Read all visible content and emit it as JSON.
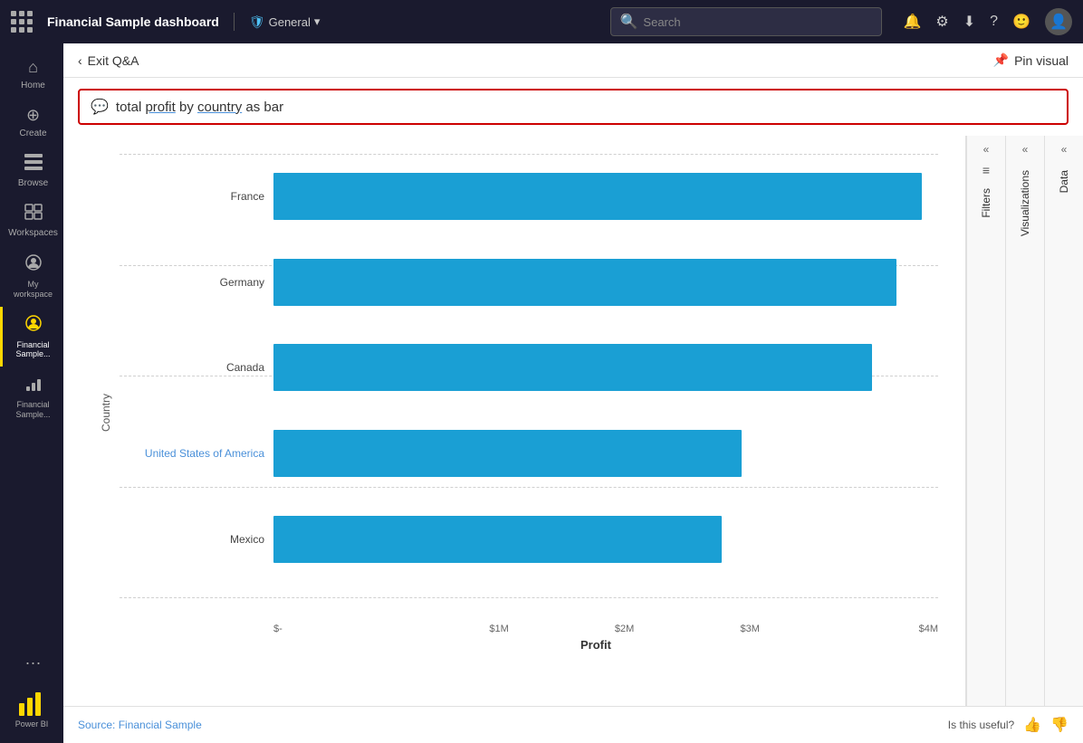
{
  "topnav": {
    "title": "Financial Sample  dashboard",
    "divider": "|",
    "general_label": "General",
    "search_placeholder": "Search",
    "icons": [
      "bell",
      "gear",
      "download",
      "question",
      "smiley",
      "user"
    ]
  },
  "sidebar": {
    "items": [
      {
        "id": "home",
        "icon": "⌂",
        "label": "Home"
      },
      {
        "id": "create",
        "icon": "⊕",
        "label": "Create"
      },
      {
        "id": "browse",
        "icon": "☰",
        "label": "Browse"
      },
      {
        "id": "workspaces",
        "icon": "⬛",
        "label": "Workspaces"
      },
      {
        "id": "my-workspace",
        "icon": "◉",
        "label": "My workspace"
      },
      {
        "id": "financial-sample-1",
        "icon": "◉",
        "label": "Financial Sample..."
      },
      {
        "id": "financial-sample-2",
        "icon": "▥",
        "label": "Financial Sample..."
      }
    ],
    "more_label": "...",
    "powerbi_label": "Power BI"
  },
  "qa": {
    "back_label": "Exit Q&A",
    "pin_label": "Pin visual",
    "query": "total profit by country as bar",
    "query_parts": {
      "prefix": "total ",
      "underline1": "profit",
      "mid": " by ",
      "underline2": "country",
      "suffix": " as bar"
    }
  },
  "chart": {
    "title": "total profit by country as bar",
    "y_axis_label": "Country",
    "x_axis_label": "Profit",
    "x_ticks": [
      "$-",
      "$1M",
      "$2M",
      "$3M",
      "$4M"
    ],
    "max_value": 4000000,
    "bars": [
      {
        "country": "France",
        "value": 3900000,
        "highlight": false
      },
      {
        "country": "Germany",
        "value": 3750000,
        "highlight": false
      },
      {
        "country": "Canada",
        "value": 3600000,
        "highlight": false
      },
      {
        "country": "United States of America",
        "value": 2820000,
        "highlight": true
      },
      {
        "country": "Mexico",
        "value": 2700000,
        "highlight": false
      }
    ],
    "grid_lines": 5
  },
  "right_panels": [
    {
      "id": "filters",
      "label": "Filters",
      "icon": "≡"
    },
    {
      "id": "visualizations",
      "label": "Visualizations"
    },
    {
      "id": "data",
      "label": "Data"
    }
  ],
  "footer": {
    "source_label": "Source:",
    "source_link": "Financial Sample",
    "feedback_label": "Is this useful?",
    "thumbup_label": "👍",
    "thumbdown_label": "👎"
  }
}
